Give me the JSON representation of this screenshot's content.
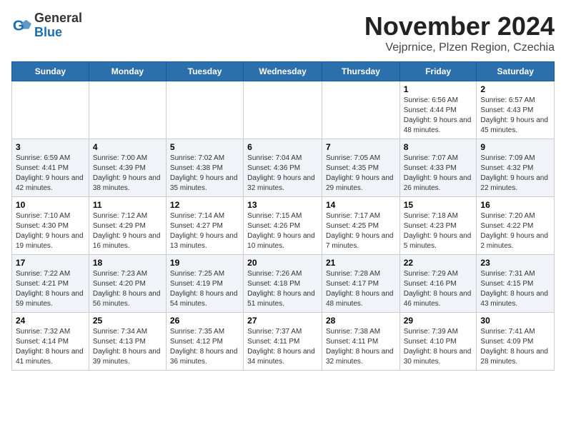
{
  "logo": {
    "general": "General",
    "blue": "Blue"
  },
  "title": "November 2024",
  "location": "Vejprnice, Plzen Region, Czechia",
  "days_of_week": [
    "Sunday",
    "Monday",
    "Tuesday",
    "Wednesday",
    "Thursday",
    "Friday",
    "Saturday"
  ],
  "weeks": [
    [
      {
        "day": "",
        "info": ""
      },
      {
        "day": "",
        "info": ""
      },
      {
        "day": "",
        "info": ""
      },
      {
        "day": "",
        "info": ""
      },
      {
        "day": "",
        "info": ""
      },
      {
        "day": "1",
        "info": "Sunrise: 6:56 AM\nSunset: 4:44 PM\nDaylight: 9 hours and 48 minutes."
      },
      {
        "day": "2",
        "info": "Sunrise: 6:57 AM\nSunset: 4:43 PM\nDaylight: 9 hours and 45 minutes."
      }
    ],
    [
      {
        "day": "3",
        "info": "Sunrise: 6:59 AM\nSunset: 4:41 PM\nDaylight: 9 hours and 42 minutes."
      },
      {
        "day": "4",
        "info": "Sunrise: 7:00 AM\nSunset: 4:39 PM\nDaylight: 9 hours and 38 minutes."
      },
      {
        "day": "5",
        "info": "Sunrise: 7:02 AM\nSunset: 4:38 PM\nDaylight: 9 hours and 35 minutes."
      },
      {
        "day": "6",
        "info": "Sunrise: 7:04 AM\nSunset: 4:36 PM\nDaylight: 9 hours and 32 minutes."
      },
      {
        "day": "7",
        "info": "Sunrise: 7:05 AM\nSunset: 4:35 PM\nDaylight: 9 hours and 29 minutes."
      },
      {
        "day": "8",
        "info": "Sunrise: 7:07 AM\nSunset: 4:33 PM\nDaylight: 9 hours and 26 minutes."
      },
      {
        "day": "9",
        "info": "Sunrise: 7:09 AM\nSunset: 4:32 PM\nDaylight: 9 hours and 22 minutes."
      }
    ],
    [
      {
        "day": "10",
        "info": "Sunrise: 7:10 AM\nSunset: 4:30 PM\nDaylight: 9 hours and 19 minutes."
      },
      {
        "day": "11",
        "info": "Sunrise: 7:12 AM\nSunset: 4:29 PM\nDaylight: 9 hours and 16 minutes."
      },
      {
        "day": "12",
        "info": "Sunrise: 7:14 AM\nSunset: 4:27 PM\nDaylight: 9 hours and 13 minutes."
      },
      {
        "day": "13",
        "info": "Sunrise: 7:15 AM\nSunset: 4:26 PM\nDaylight: 9 hours and 10 minutes."
      },
      {
        "day": "14",
        "info": "Sunrise: 7:17 AM\nSunset: 4:25 PM\nDaylight: 9 hours and 7 minutes."
      },
      {
        "day": "15",
        "info": "Sunrise: 7:18 AM\nSunset: 4:23 PM\nDaylight: 9 hours and 5 minutes."
      },
      {
        "day": "16",
        "info": "Sunrise: 7:20 AM\nSunset: 4:22 PM\nDaylight: 9 hours and 2 minutes."
      }
    ],
    [
      {
        "day": "17",
        "info": "Sunrise: 7:22 AM\nSunset: 4:21 PM\nDaylight: 8 hours and 59 minutes."
      },
      {
        "day": "18",
        "info": "Sunrise: 7:23 AM\nSunset: 4:20 PM\nDaylight: 8 hours and 56 minutes."
      },
      {
        "day": "19",
        "info": "Sunrise: 7:25 AM\nSunset: 4:19 PM\nDaylight: 8 hours and 54 minutes."
      },
      {
        "day": "20",
        "info": "Sunrise: 7:26 AM\nSunset: 4:18 PM\nDaylight: 8 hours and 51 minutes."
      },
      {
        "day": "21",
        "info": "Sunrise: 7:28 AM\nSunset: 4:17 PM\nDaylight: 8 hours and 48 minutes."
      },
      {
        "day": "22",
        "info": "Sunrise: 7:29 AM\nSunset: 4:16 PM\nDaylight: 8 hours and 46 minutes."
      },
      {
        "day": "23",
        "info": "Sunrise: 7:31 AM\nSunset: 4:15 PM\nDaylight: 8 hours and 43 minutes."
      }
    ],
    [
      {
        "day": "24",
        "info": "Sunrise: 7:32 AM\nSunset: 4:14 PM\nDaylight: 8 hours and 41 minutes."
      },
      {
        "day": "25",
        "info": "Sunrise: 7:34 AM\nSunset: 4:13 PM\nDaylight: 8 hours and 39 minutes."
      },
      {
        "day": "26",
        "info": "Sunrise: 7:35 AM\nSunset: 4:12 PM\nDaylight: 8 hours and 36 minutes."
      },
      {
        "day": "27",
        "info": "Sunrise: 7:37 AM\nSunset: 4:11 PM\nDaylight: 8 hours and 34 minutes."
      },
      {
        "day": "28",
        "info": "Sunrise: 7:38 AM\nSunset: 4:11 PM\nDaylight: 8 hours and 32 minutes."
      },
      {
        "day": "29",
        "info": "Sunrise: 7:39 AM\nSunset: 4:10 PM\nDaylight: 8 hours and 30 minutes."
      },
      {
        "day": "30",
        "info": "Sunrise: 7:41 AM\nSunset: 4:09 PM\nDaylight: 8 hours and 28 minutes."
      }
    ]
  ]
}
